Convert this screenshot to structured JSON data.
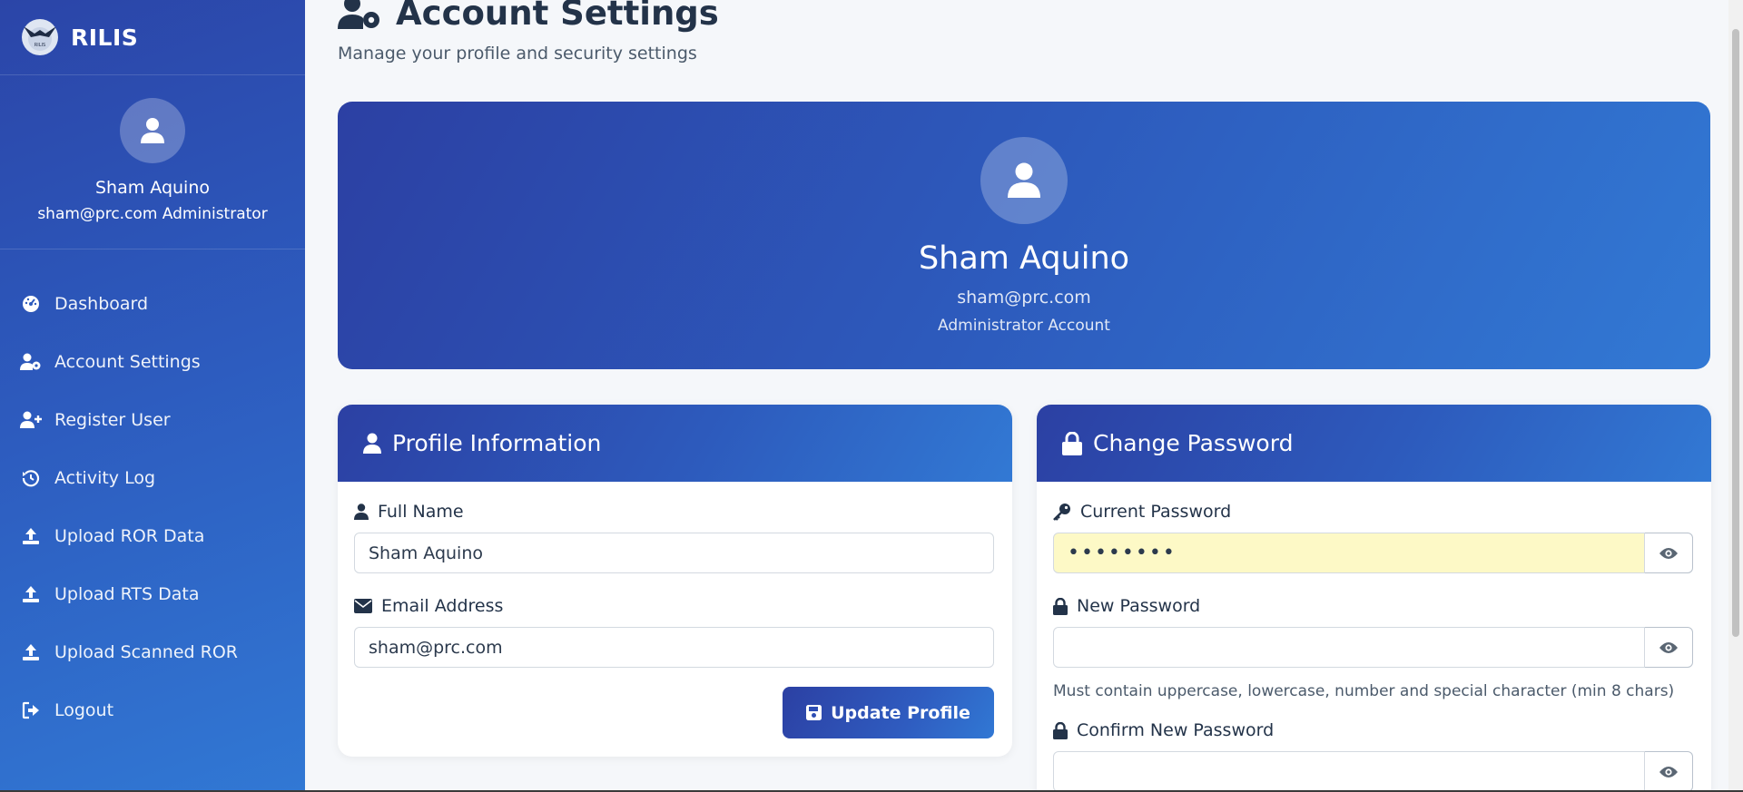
{
  "brand": {
    "name": "RILIS",
    "logo_text": "RILIS"
  },
  "sidebar": {
    "user": {
      "name": "Sham Aquino",
      "email_role": "sham@prc.com Administrator"
    },
    "items": [
      {
        "label": "Dashboard",
        "icon": "gauge-icon"
      },
      {
        "label": "Account Settings",
        "icon": "user-gear-icon"
      },
      {
        "label": "Register User",
        "icon": "user-plus-icon"
      },
      {
        "label": "Activity Log",
        "icon": "history-icon"
      },
      {
        "label": "Upload ROR Data",
        "icon": "upload-icon"
      },
      {
        "label": "Upload RTS Data",
        "icon": "upload-icon"
      },
      {
        "label": "Upload Scanned ROR",
        "icon": "upload-icon"
      },
      {
        "label": "Logout",
        "icon": "sign-out-icon"
      }
    ]
  },
  "page": {
    "title": "Account Settings",
    "subtitle": "Manage your profile and security settings"
  },
  "hero": {
    "name": "Sham Aquino",
    "email": "sham@prc.com",
    "role": "Administrator Account"
  },
  "profile": {
    "title": "Profile Information",
    "full_name_label": "Full Name",
    "full_name_value": "Sham Aquino",
    "email_label": "Email Address",
    "email_value": "sham@prc.com",
    "update_button": "Update Profile"
  },
  "password": {
    "title": "Change Password",
    "current_label": "Current Password",
    "current_value": "••••••••",
    "new_label": "New Password",
    "new_value": "",
    "hint": "Must contain uppercase, lowercase, number and special character (min 8 chars)",
    "confirm_label": "Confirm New Password",
    "confirm_value": ""
  },
  "colors": {
    "sidebar_start": "#2b45a8",
    "sidebar_end": "#3178d4",
    "heading": "#233349",
    "autofill": "#fdf9c6"
  }
}
